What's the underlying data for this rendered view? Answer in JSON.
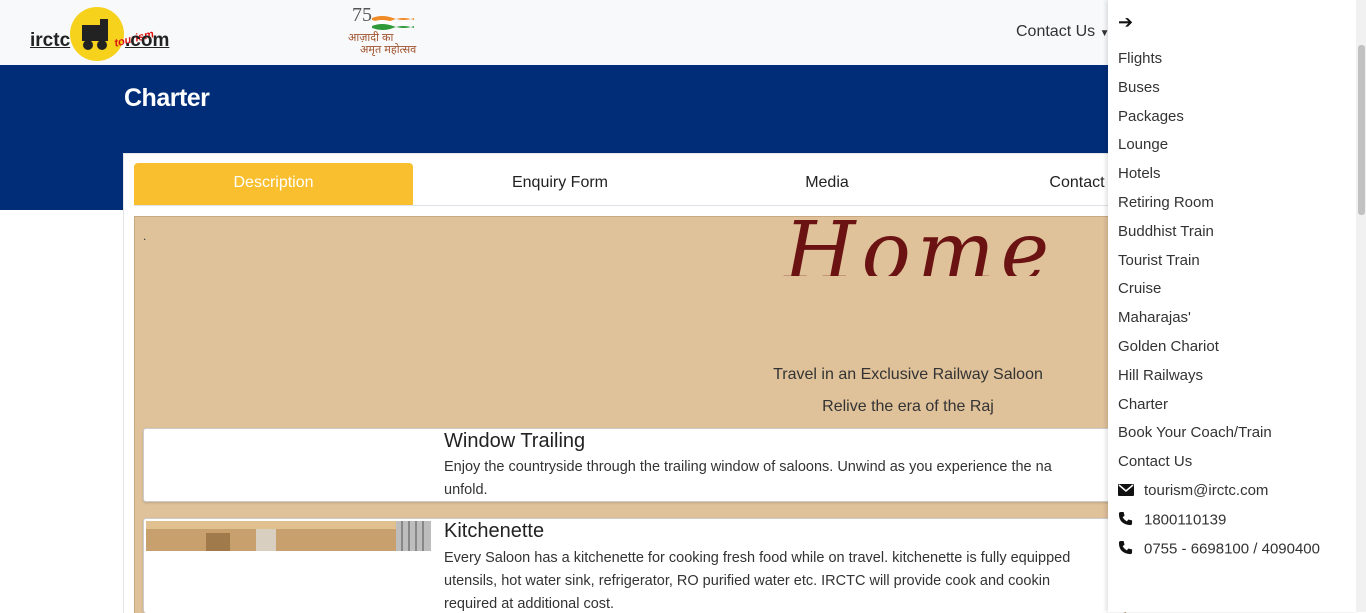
{
  "header": {
    "logo": {
      "prefix": "irctc",
      "middle": "tourism",
      "suffix": ".com"
    },
    "azadi": {
      "number": "75",
      "line1": "आज़ादी का",
      "line2": "अमृत महोत्सव"
    },
    "contact_label": "Contact Us"
  },
  "page": {
    "title": "Charter"
  },
  "tabs": [
    {
      "label": "Description",
      "active": true
    },
    {
      "label": "Enquiry Form",
      "active": false
    },
    {
      "label": "Media",
      "active": false
    },
    {
      "label": "Contact",
      "active": false
    }
  ],
  "banner": {
    "dot": ".",
    "word": "Home",
    "tagline1": "Travel in an Exclusive Railway Saloon",
    "tagline2": "Relive the era of the Raj"
  },
  "features": [
    {
      "title": "Window Trailing",
      "text": "Enjoy the countryside through the trailing window of saloons. Unwind as you experience the na",
      "text2": "unfold."
    },
    {
      "title": "Kitchenette",
      "text": "Every Saloon has a kitchenette for cooking fresh food while on travel. kitchenette is fully equipped",
      "text2": "utensils, hot water sink, refrigerator, RO purified water etc. IRCTC will provide cook and cookin",
      "text3": "required at additional cost."
    }
  ],
  "sidebar": {
    "items": [
      "Flights",
      "Buses",
      "Packages",
      "Lounge",
      "Hotels",
      "Retiring Room",
      "Buddhist Train",
      "Tourist Train",
      "Cruise",
      "Maharajas'",
      "Golden Chariot",
      "Hill Railways",
      "Charter",
      "Book Your Coach/Train",
      "Contact Us"
    ],
    "contacts": [
      {
        "icon": "envelope-icon",
        "text": "tourism@irctc.com"
      },
      {
        "icon": "phone-icon",
        "text": "1800110139"
      },
      {
        "icon": "phone-icon",
        "text": "0755 - 6698100 / 4090400"
      }
    ]
  },
  "colors": {
    "band": "#002c78",
    "tab_active": "#f9bf2e",
    "banner_bg": "#dfc19a",
    "home_text": "#6b1212"
  }
}
